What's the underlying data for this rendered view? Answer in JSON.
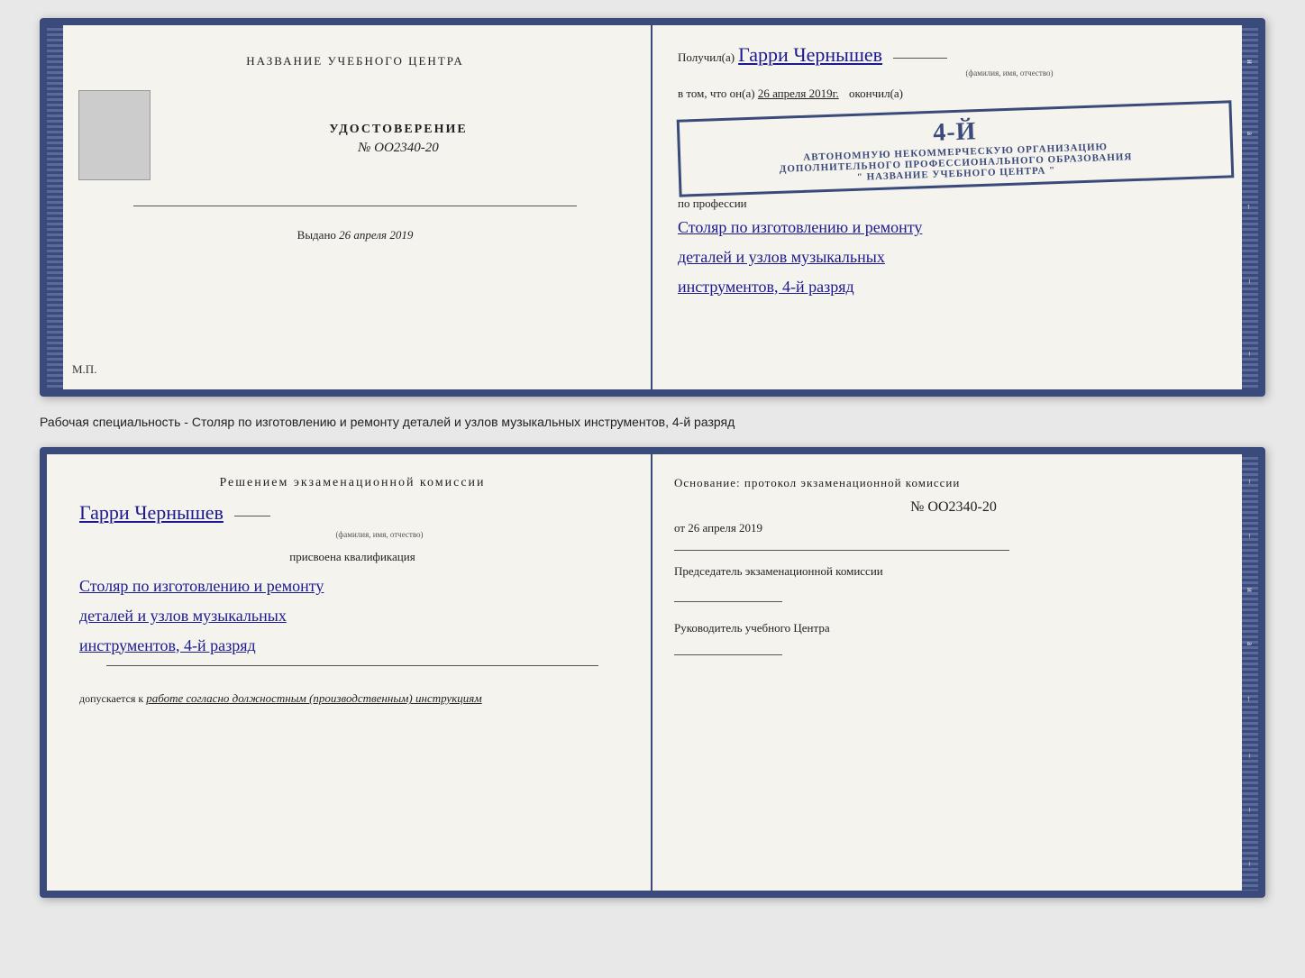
{
  "top_spread": {
    "left_page": {
      "institution_title": "НАЗВАНИЕ УЧЕБНОГО ЦЕНТРА",
      "document_type": "УДОСТОВЕРЕНИЕ",
      "doc_number": "№ OO2340-20",
      "vydano_label": "Выдано",
      "vydano_date": "26 апреля 2019",
      "mp_label": "М.П."
    },
    "right_page": {
      "poluchil_label": "Получил(а)",
      "recipient_name": "Гарри Чернышев",
      "fio_label": "(фамилия, имя, отчество)",
      "vtom_label": "в том, что он(а)",
      "date_handwritten": "26 апреля 2019г.",
      "okonchil_label": "окончил(а)",
      "stamp_line1": "4-й",
      "stamp_org_line1": "АВТОНОМНУЮ НЕКОММЕРЧЕСКУЮ ОРГАНИЗАЦИЮ",
      "stamp_org_line2": "ДОПОЛНИТЕЛЬНОГО ПРОФЕССИОНАЛЬНОГО ОБРАЗОВАНИЯ",
      "stamp_org_line3": "\" НАЗВАНИЕ УЧЕБНОГО ЦЕНТРА \"",
      "po_professii_label": "по профессии",
      "profession_line1": "Столяр по изготовлению и ремонту",
      "profession_line2": "деталей и узлов музыкальных",
      "profession_line3": "инструментов, 4-й разряд"
    }
  },
  "caption": "Рабочая специальность - Столяр по изготовлению и ремонту деталей и узлов музыкальных инструментов, 4-й разряд",
  "bottom_spread": {
    "left_page": {
      "resheniem_title": "Решением экзаменационной комиссии",
      "recipient_name": "Гарри Чернышев",
      "fio_label": "(фамилия, имя, отчество)",
      "prisvoena_label": "присвоена квалификация",
      "qualification_line1": "Столяр по изготовлению и ремонту",
      "qualification_line2": "деталей и узлов музыкальных",
      "qualification_line3": "инструментов, 4-й разряд",
      "dopuskaetsya_label": "допускается к",
      "dopusk_value": "работе согласно должностным (производственным) инструкциям"
    },
    "right_page": {
      "osnovanie_label": "Основание: протокол экзаменационной комиссии",
      "protocol_number": "№ OO2340-20",
      "ot_label": "от",
      "ot_date": "26 апреля 2019",
      "chairman_label": "Председатель экзаменационной комиссии",
      "rukovoditel_label": "Руководитель учебного Центра"
    }
  },
  "right_spine_letters": [
    "и",
    "а",
    "←",
    "–",
    "–",
    "–",
    "–"
  ]
}
